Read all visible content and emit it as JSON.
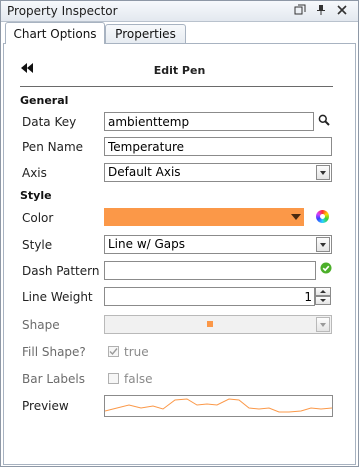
{
  "window": {
    "title": "Property Inspector"
  },
  "tabs": [
    {
      "label": "Chart Options",
      "active": true
    },
    {
      "label": "Properties",
      "active": false
    }
  ],
  "header": {
    "back_icon": "double-left-arrow-icon",
    "title": "Edit Pen"
  },
  "general": {
    "heading": "General",
    "data_key": {
      "label": "Data Key",
      "value": "ambienttemp",
      "icon": "search-icon"
    },
    "pen_name": {
      "label": "Pen Name",
      "value": "Temperature"
    },
    "axis": {
      "label": "Axis",
      "value": "Default Axis"
    }
  },
  "style": {
    "heading": "Style",
    "color": {
      "label": "Color",
      "value": "#fb9848",
      "icon": "color-wheel-icon"
    },
    "line_style": {
      "label": "Style",
      "value": "Line w/ Gaps"
    },
    "dash_pattern": {
      "label": "Dash Pattern",
      "value": "",
      "icon": "check-circle-icon"
    },
    "line_weight": {
      "label": "Line Weight",
      "value": "1"
    },
    "shape": {
      "label": "Shape",
      "disabled": true
    },
    "fill_shape": {
      "label": "Fill Shape?",
      "value": "true",
      "disabled": true
    },
    "bar_labels": {
      "label": "Bar Labels",
      "value": "false",
      "disabled": true
    },
    "preview": {
      "label": "Preview"
    }
  },
  "colors": {
    "accent": "#fb9848",
    "ok_green": "#4caf2a"
  }
}
